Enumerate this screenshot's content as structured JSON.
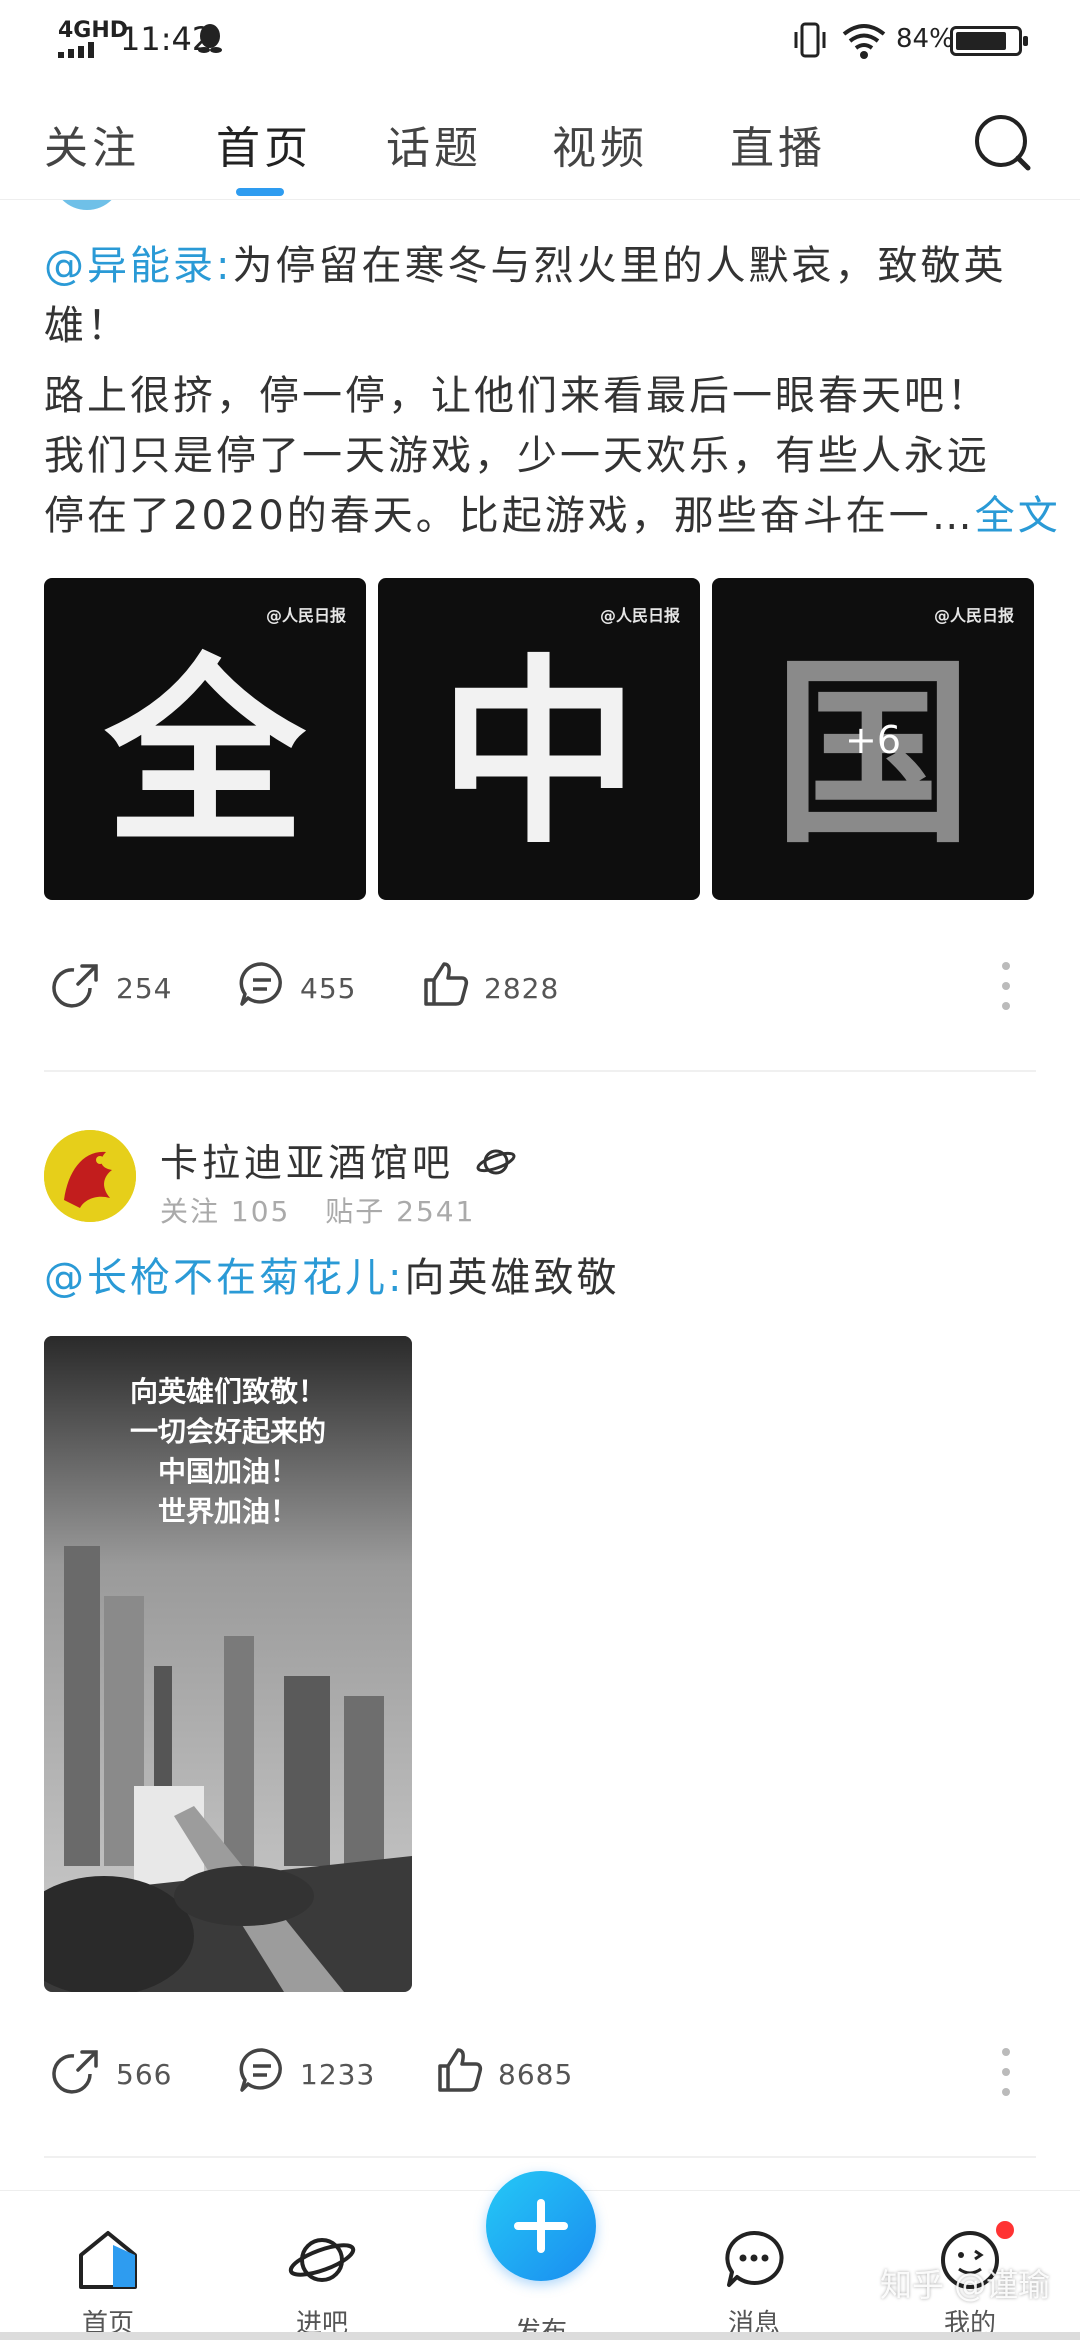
{
  "status_bar": {
    "network": "4GHD",
    "time": "11:42",
    "battery": "84%",
    "battery_level": 0.84
  },
  "top_nav": {
    "tabs": [
      {
        "label": "关注",
        "active": false
      },
      {
        "label": "首页",
        "active": true
      },
      {
        "label": "话题",
        "active": false
      },
      {
        "label": "视频",
        "active": false
      },
      {
        "label": "直播",
        "active": false
      }
    ],
    "search_icon": "search-icon"
  },
  "post1": {
    "author": "@异能录:",
    "text_line1": "为停留在寒冬与烈火里的人默哀，致敬英",
    "text_line2": "雄！",
    "text_line3": "路上很挤，停一停，让他们来看最后一眼春天吧！",
    "text_line4": "我们只是停了一天游戏，少一天欢乐，有些人永远",
    "text_line5": "停在了2020的春天。比起游戏，那些奋斗在一…",
    "more": "全文",
    "images": [
      {
        "char": "全",
        "watermark": "@人民日报"
      },
      {
        "char": "中",
        "watermark": "@人民日报"
      },
      {
        "char": "国",
        "watermark": "@人民日报",
        "overlay": "+6"
      }
    ],
    "share_count": "254",
    "comment_count": "455",
    "like_count": "2828"
  },
  "post2": {
    "forum_name": "卡拉迪亚酒馆吧",
    "follow_label": "关注 105",
    "posts_label": "贴子 2541",
    "author": "@长枪不在菊花儿:",
    "text": "向英雄致敬",
    "photo_caption": [
      "向英雄们致敬！",
      "一切会好起来的",
      "中国加油！",
      "世界加油！"
    ],
    "share_count": "566",
    "comment_count": "1233",
    "like_count": "8685"
  },
  "bottom_nav": {
    "items": [
      {
        "label": "首页"
      },
      {
        "label": "进吧"
      },
      {
        "label": "发布"
      },
      {
        "label": "消息"
      },
      {
        "label": "我的"
      }
    ]
  },
  "watermark": "知乎 @谨瑜",
  "colors": {
    "accent": "#2e9cf0",
    "mention": "#2a9ad6"
  }
}
